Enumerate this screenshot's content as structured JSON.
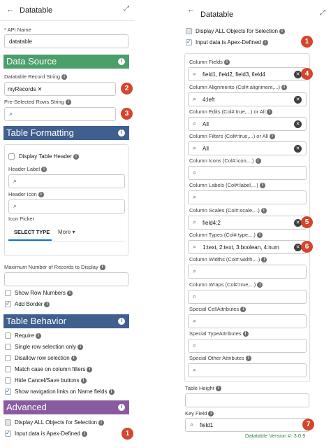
{
  "left": {
    "back_glyph": "←",
    "title": "Datatable",
    "expand_glyph": "⤢",
    "api_name_label": "* API Name",
    "api_name_value": "datatable",
    "data_source_title": "Data Source",
    "record_string_label": "Datatable Record String",
    "record_pill": "myRecords",
    "preselected_label": "Pre-Selected Rows String",
    "table_formatting_title": "Table Formatting",
    "display_header_label": "Display Table Header",
    "header_label_label": "Header Label",
    "header_icon_label": "Header Icon",
    "icon_picker_label": "Icon Picker",
    "select_type_tab": "SELECT TYPE",
    "more_tab": "More",
    "max_records_label": "Maximum Number of Records to Display",
    "show_row_numbers": "Show Row Numbers",
    "add_border": "Add Border",
    "table_behavior_title": "Table Behavior",
    "require": "Require",
    "single_row": "Single row selection only",
    "disallow_row": "Disallow row selection",
    "match_case": "Match case on column filters",
    "hide_cancel": "Hide Cancel/Save buttons",
    "show_nav": "Show navigation links on Name fields",
    "advanced_title": "Advanced",
    "display_all": "Display ALL Objects for Selection",
    "apex_defined": "Input data is Apex-Defined"
  },
  "right": {
    "back_glyph": "←",
    "title": "Datatable",
    "expand_glyph": "⤢",
    "display_all": "Display ALL Objects for Selection",
    "apex_defined": "Input data is Apex-Defined",
    "column_fields_label": "Column Fields",
    "column_fields_value": "field1, field2, field3, field4",
    "col_align_label": "Column Alignments (Col#:alignment,...)",
    "col_align_value": "4:left",
    "col_edits_label": "Column Edits (Col#:true,...) or All",
    "col_edits_value": "All",
    "col_filters_label": "Column Filters (Col#:true,...) or All",
    "col_filters_value": "All",
    "col_icons_label": "Column Icons (Col#:icon,...)",
    "col_labels_label": "Column Labels (Col#:label,...)",
    "col_scales_label": "Column Scales (Col#:scale,...)",
    "col_scales_value": "field4:2",
    "col_types_label": "Column Types (Col#:type,...)",
    "col_types_value": "1:text, 2:text, 3:boolean, 4:num",
    "col_widths_label": "Column Widths (Col#:width,...)",
    "col_wraps_label": "Column Wraps (Col#:true,...)",
    "special_cell_label": "Special CellAttributes",
    "special_type_label": "Special TypeAttributes",
    "special_other_label": "Special Other Attributes",
    "table_height_label": "Table Height",
    "key_field_label": "Key Field",
    "key_field_value": "field1",
    "version": "Datatable Version #: 3.0.9"
  },
  "badges": [
    "1",
    "2",
    "3",
    "4",
    "5",
    "6",
    "7",
    "1"
  ],
  "colors": {
    "data_source": "#4b9f6a",
    "table_formatting": "#3f5f8f",
    "table_behavior": "#3f5f8f",
    "advanced": "#8a5aa0",
    "badge": "#d4452c",
    "version": "#2e844a"
  },
  "icons": {
    "search": "search-icon",
    "clear": "clear-icon",
    "info": "info-icon"
  }
}
